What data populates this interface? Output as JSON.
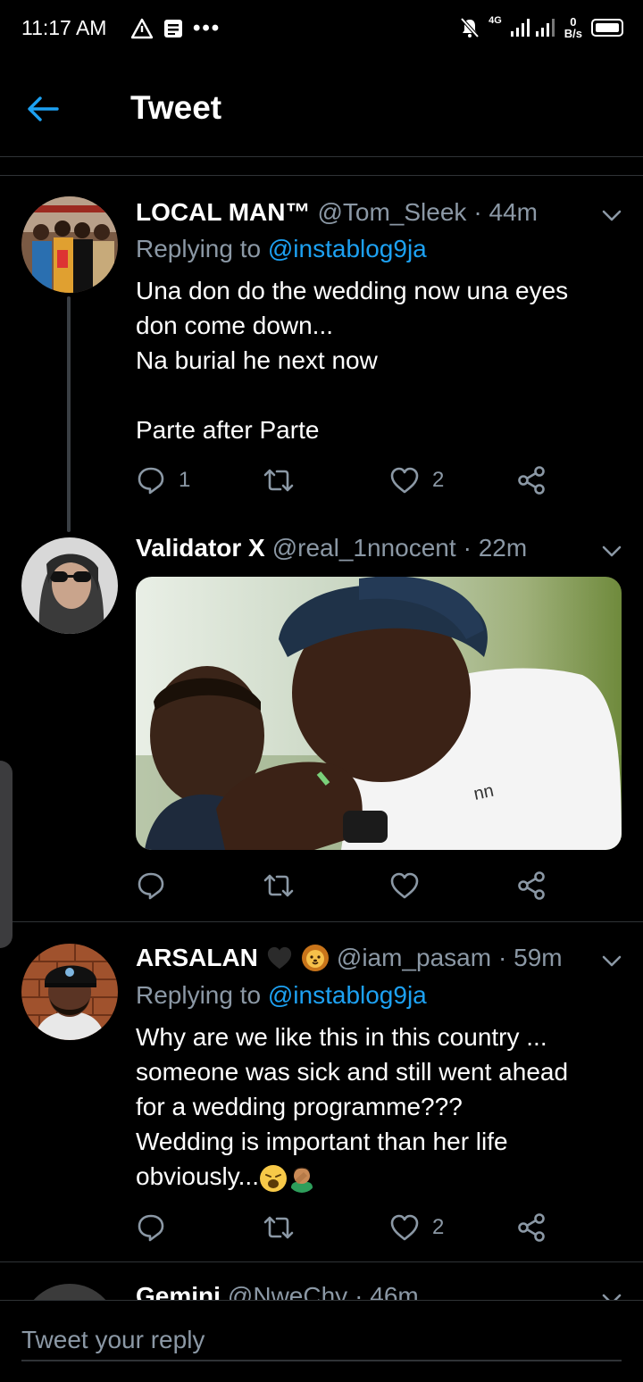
{
  "status_bar": {
    "time": "11:17 AM",
    "network": "4G",
    "speed_value": "0",
    "speed_unit": "B/s",
    "more_dots": "•••"
  },
  "header": {
    "title": "Tweet",
    "back_icon": "arrow-left-icon"
  },
  "colors": {
    "accent": "#1da1f2",
    "muted": "#8b98a5",
    "background": "#000000",
    "divider": "#2f3336"
  },
  "tweets": [
    {
      "name": "LOCAL MAN™",
      "handle": "@Tom_Sleek",
      "time": "· 44m",
      "replying_prefix": "Replying to",
      "replying_to": "@instablog9ja",
      "body": "Una don do the wedding now una eyes\ndon come down...\nNa burial he next now\n\nParte after Parte",
      "reply_count": "1",
      "retweet_count": "",
      "like_count": "2"
    },
    {
      "name": "Validator X",
      "handle": "@real_1nnocent",
      "time": "· 22m",
      "reply_count": "",
      "retweet_count": "",
      "like_count": ""
    },
    {
      "name": "ARSALAN",
      "name_emojis": [
        "black-heart-emoji",
        "lion-emoji"
      ],
      "handle": "@iam_pasam",
      "time": "· 59m",
      "replying_prefix": "Replying to",
      "replying_to": "@instablog9ja",
      "body": "Why are we like this in this country ...\nsomeone was sick and still went ahead\nfor a wedding programme???\nWedding is important than her life\nobviously...",
      "body_emojis": [
        "weary-face-emoji",
        "man-facepalming-emoji"
      ],
      "reply_count": "",
      "retweet_count": "",
      "like_count": "2"
    },
    {
      "name": "Gemini",
      "handle": "@NweChy",
      "time": "· 46m"
    }
  ],
  "reply_bar": {
    "placeholder": "Tweet your reply"
  }
}
